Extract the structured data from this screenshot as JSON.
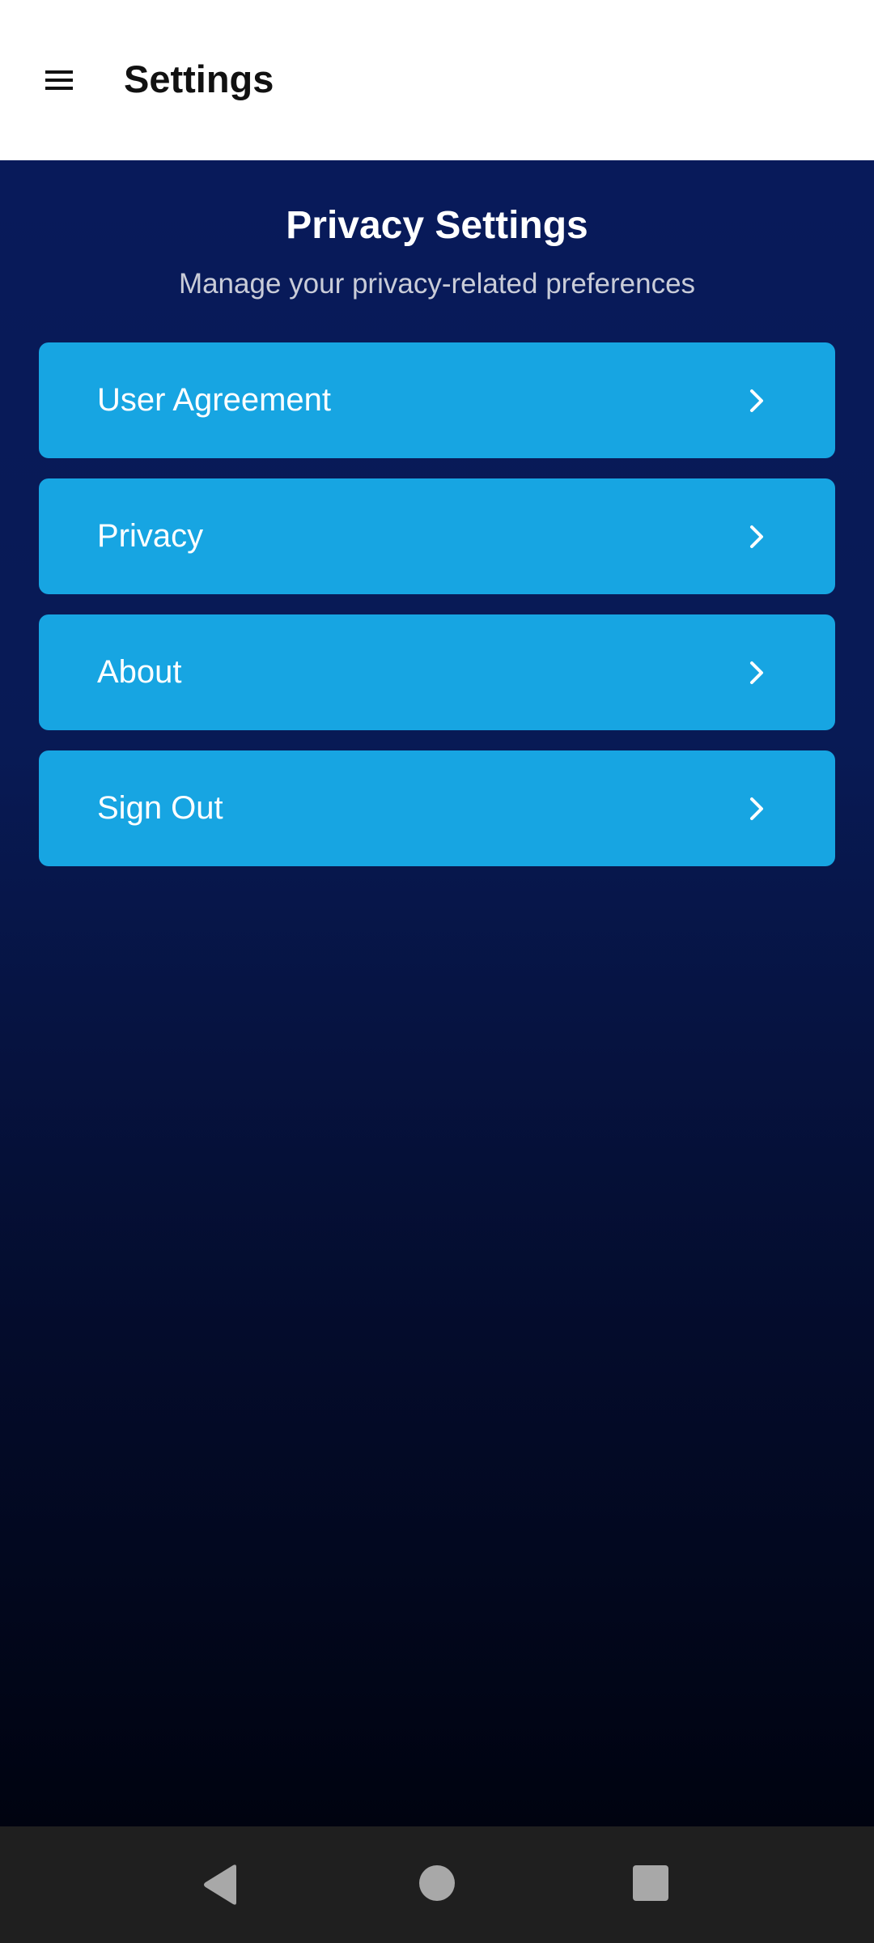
{
  "app_bar": {
    "title": "Settings",
    "menu_icon": "hamburger-menu-icon"
  },
  "page": {
    "heading": "Privacy Settings",
    "subtitle": "Manage your privacy-related preferences"
  },
  "menu": {
    "items": [
      {
        "label": "User Agreement",
        "icon": "chevron-right-icon"
      },
      {
        "label": "Privacy",
        "icon": "chevron-right-icon"
      },
      {
        "label": "About",
        "icon": "chevron-right-icon"
      },
      {
        "label": "Sign Out",
        "icon": "chevron-right-icon"
      }
    ]
  },
  "nav_bar": {
    "icons": [
      "back-triangle-icon",
      "home-circle-icon",
      "recents-square-icon"
    ]
  },
  "colors": {
    "app_bar_bg": "#ffffff",
    "content_top": "#081a5a",
    "content_bottom": "#000310",
    "menu_item_bg": "#17a5e2",
    "nav_bar_bg": "#1f1f1f",
    "nav_icon": "#a8a8a8"
  }
}
